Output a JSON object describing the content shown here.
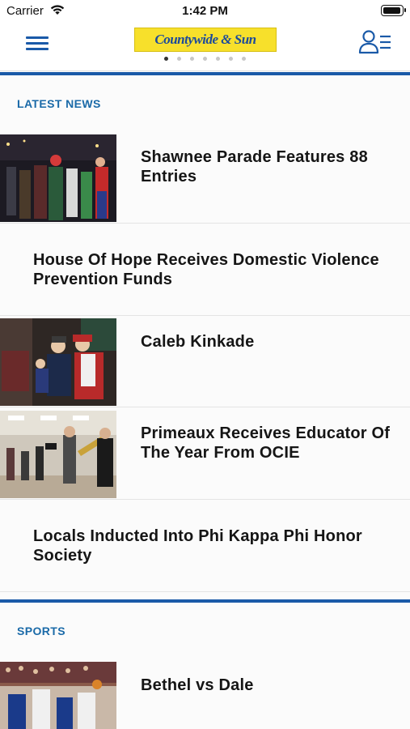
{
  "status_bar": {
    "carrier": "Carrier",
    "time": "1:42 PM",
    "battery_level": 1.0
  },
  "nav": {
    "logo_text": "Countywide & Sun",
    "menu_icon": "hamburger-menu-icon",
    "profile_icon": "user-list-icon",
    "page_count": 7,
    "active_page": 1,
    "accent_color": "#1a5aa8",
    "logo_color": "#f7e02b"
  },
  "sections": [
    {
      "title": "LATEST NEWS",
      "articles": [
        {
          "title": "Shawnee Parade Features 88 Entries",
          "has_image": true
        },
        {
          "title": "House Of Hope Receives Domestic Violence Prevention Funds",
          "has_image": false
        },
        {
          "title": "Caleb Kinkade",
          "has_image": true
        },
        {
          "title": "Primeaux Receives Educator Of The Year From OCIE",
          "has_image": true
        },
        {
          "title": "Locals Inducted Into Phi Kappa Phi Honor Society",
          "has_image": false
        }
      ]
    },
    {
      "title": "SPORTS",
      "articles": [
        {
          "title": "Bethel vs Dale",
          "has_image": true
        }
      ]
    }
  ]
}
